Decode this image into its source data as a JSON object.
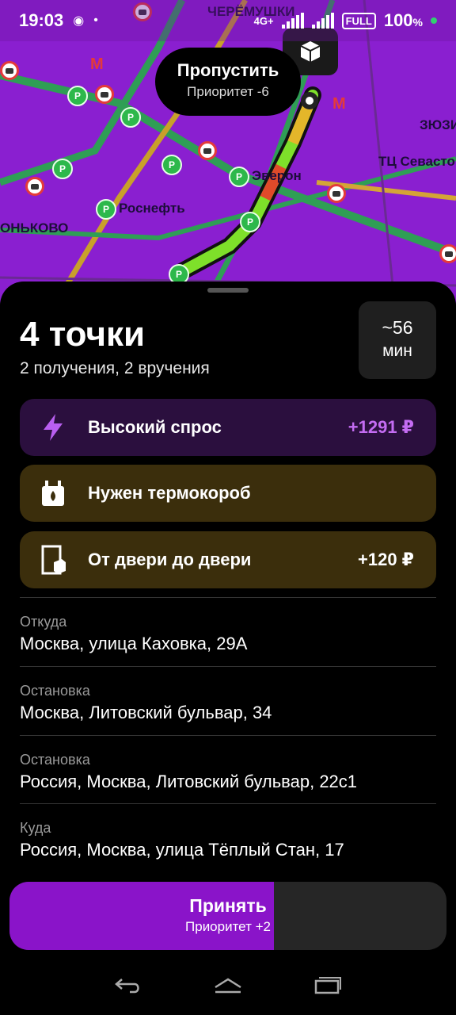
{
  "status_bar": {
    "time": "19:03",
    "network": "4G+",
    "full_badge": "FULL",
    "battery": "100",
    "battery_unit": "%"
  },
  "map": {
    "labels": {
      "top_district": "ЧЕРЁМУШКИ",
      "zyuz": "ЗЮЗИ",
      "tc": "ТЦ Севастоп",
      "everon": "Эверон",
      "rosneft": "Роснефть",
      "konkovo": "ОНЬКОВО"
    },
    "skip_bubble": {
      "title": "Пропустить",
      "subtitle": "Приоритет -6"
    },
    "box_icon": "package-box-icon"
  },
  "order": {
    "title": "4 точки",
    "subtitle": "2 получения, 2 вручения",
    "eta_value": "~56",
    "eta_unit": "мин"
  },
  "chips": [
    {
      "icon": "lightning-icon",
      "label": "Высокий спрос",
      "value": "+1291 ₽",
      "color": "#c46cf2"
    },
    {
      "icon": "thermo-box-icon",
      "label": "Нужен термокороб",
      "value": ""
    },
    {
      "icon": "door-package-icon",
      "label": "От двери до двери",
      "value": "+120 ₽"
    }
  ],
  "addresses": [
    {
      "caption": "Откуда",
      "value": "Москва, улица Каховка, 29А"
    },
    {
      "caption": "Остановка",
      "value": "Москва, Литовский бульвар, 34"
    },
    {
      "caption": "Остановка",
      "value": "Россия, Москва, Литовский бульвар, 22с1"
    },
    {
      "caption": "Куда",
      "value": "Россия, Москва, улица Тёплый Стан, 17"
    }
  ],
  "accept": {
    "title": "Принять",
    "subtitle": "Приоритет +2",
    "progress": 0.605,
    "color": "#8a14c9"
  },
  "nav": {
    "back": "back-icon",
    "home": "home-icon",
    "recents": "recents-icon"
  }
}
